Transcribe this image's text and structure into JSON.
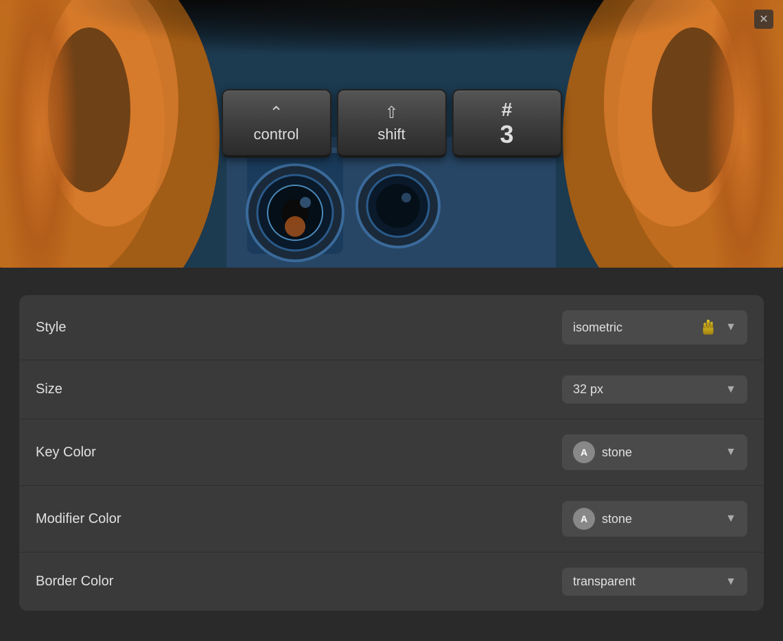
{
  "header": {
    "close_label": "✕"
  },
  "keys": [
    {
      "id": "control",
      "icon": "⌃",
      "label": "control"
    },
    {
      "id": "shift",
      "icon": "⇧",
      "label": "shift"
    },
    {
      "id": "hash3",
      "icon": "#",
      "label": "3"
    }
  ],
  "settings": {
    "rows": [
      {
        "id": "style",
        "label": "Style",
        "value": "isometric",
        "has_cursor": true,
        "has_color_badge": false
      },
      {
        "id": "size",
        "label": "Size",
        "value": "32 px",
        "has_cursor": false,
        "has_color_badge": false
      },
      {
        "id": "key_color",
        "label": "Key Color",
        "value": "stone",
        "has_cursor": false,
        "has_color_badge": true,
        "badge_text": "A"
      },
      {
        "id": "modifier_color",
        "label": "Modifier Color",
        "value": "stone",
        "has_cursor": false,
        "has_color_badge": true,
        "badge_text": "A"
      },
      {
        "id": "border_color",
        "label": "Border Color",
        "value": "transparent",
        "has_cursor": false,
        "has_color_badge": false
      }
    ]
  },
  "colors": {
    "background": "#2a2a2a",
    "panel": "#3a3a3a",
    "control": "#4a4a4a",
    "text_primary": "#e0e0e0",
    "text_secondary": "#aaa",
    "accent": "#c8b040"
  }
}
